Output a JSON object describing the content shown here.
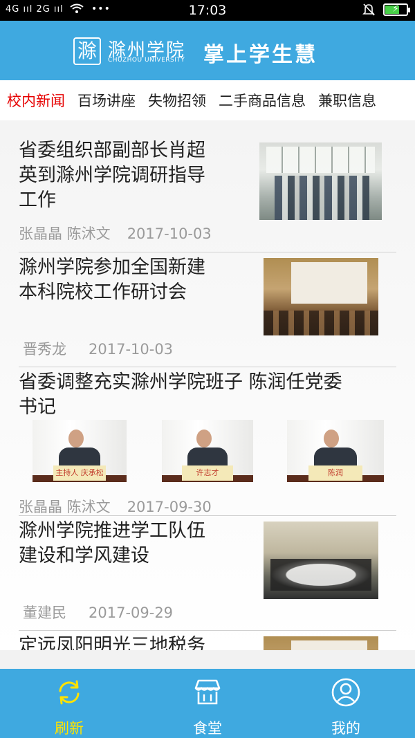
{
  "status_bar": {
    "left_text": "4G ııl 2G ııl",
    "time": "17:03"
  },
  "header": {
    "school_logo_glyph": "滁",
    "school_name": "滁州学院",
    "school_name_en": "CHUZHOU UNIVERSITY",
    "app_title": "掌上学生慧"
  },
  "tabs": [
    {
      "label": "校内新闻",
      "active": true
    },
    {
      "label": "百场讲座",
      "active": false
    },
    {
      "label": "失物招领",
      "active": false
    },
    {
      "label": "二手商品信息",
      "active": false
    },
    {
      "label": "兼职信息",
      "active": false
    }
  ],
  "news": [
    {
      "title_lines": [
        "省委组织部副部长肖超",
        "英到滁州学院调研指导",
        "工作"
      ],
      "authors": "张晶晶 陈沭文",
      "date": "2017-10-03"
    },
    {
      "title_lines": [
        "滁州学院参加全国新建",
        "本科院校工作研讨会"
      ],
      "authors": "晋秀龙",
      "date": "2017-10-03"
    },
    {
      "title_lines": [
        "省委调整充实滁州学院班子 陈润任党委",
        "书记"
      ],
      "photo_captions": [
        "主持人 庆承松",
        "许志才",
        "陈润"
      ],
      "authors": "张晶晶 陈沭文",
      "date": "2017-09-30"
    },
    {
      "title_lines": [
        "滁州学院推进学工队伍",
        "建设和学风建设"
      ],
      "authors": "董建民",
      "date": "2017-09-29"
    },
    {
      "title_lines": [
        "定远凤阳明光三地税务"
      ]
    }
  ],
  "bottom_nav": [
    {
      "label": "刷新",
      "icon": "refresh-icon",
      "active": true
    },
    {
      "label": "食堂",
      "icon": "canteen-icon",
      "active": false
    },
    {
      "label": "我的",
      "icon": "user-icon",
      "active": false
    }
  ],
  "colors": {
    "header_bg": "#3fa9e0",
    "active_tab": "#e60000",
    "active_nav": "#ffe200"
  }
}
